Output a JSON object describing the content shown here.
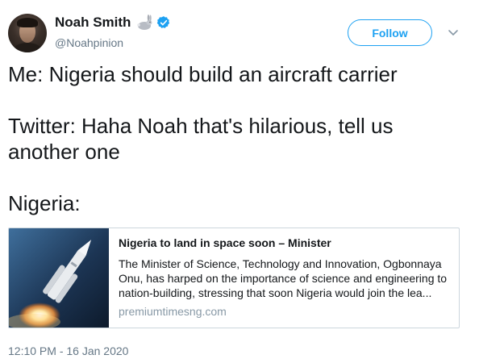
{
  "user": {
    "display_name": "Noah Smith",
    "handle": "@Noahpinion",
    "verified": true,
    "name_emoji": "rabbit-icon"
  },
  "follow_button": {
    "label": "Follow"
  },
  "tweet": {
    "lines": [
      "Me: Nigeria should build an aircraft carrier",
      "Twitter: Haha Noah that's hilarious, tell us another one",
      "Nigeria:"
    ]
  },
  "card": {
    "title": "Nigeria to land in space soon – Minister",
    "description": "The Minister of Science, Technology and Innovation, Ogbonnaya Onu, has harped on the importance of science and engineering to nation-building, stressing that soon Nigeria would join the lea...",
    "domain": "premiumtimesng.com"
  },
  "timestamp": "12:10 PM - 16 Jan 2020",
  "colors": {
    "accent": "#1da1f2",
    "muted": "#657786",
    "border": "#ccd6dd"
  }
}
